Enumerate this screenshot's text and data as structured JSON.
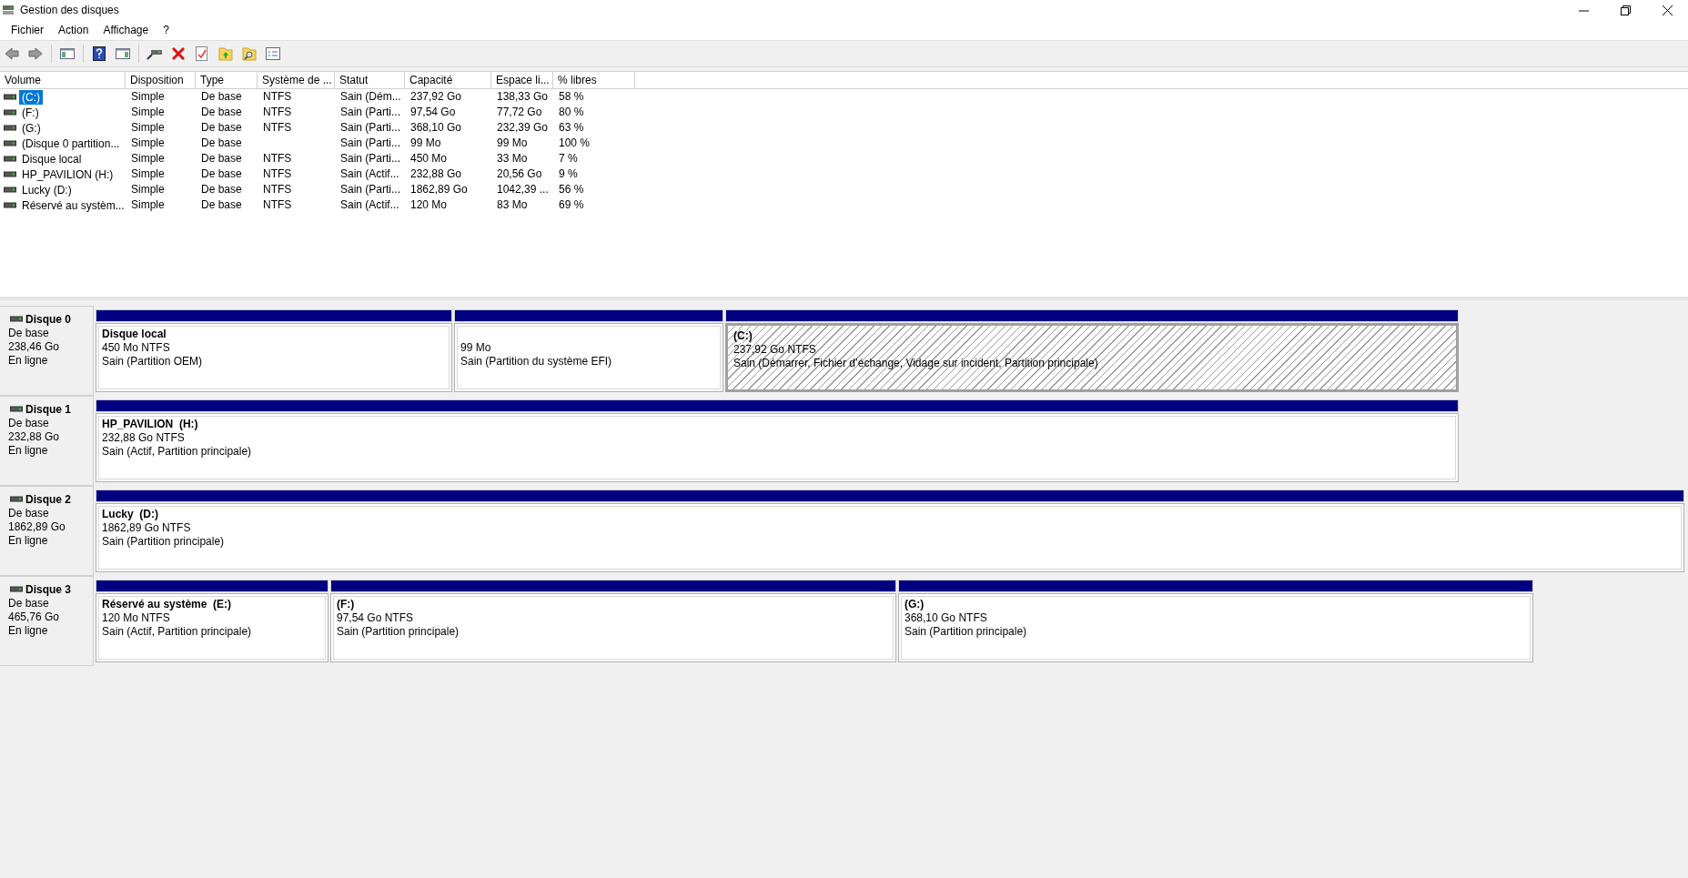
{
  "window": {
    "title": "Gestion des disques"
  },
  "menu": [
    "Fichier",
    "Action",
    "Affichage",
    "?"
  ],
  "table": {
    "columns": [
      "Volume",
      "Disposition",
      "Type",
      "Système de ...",
      "Statut",
      "Capacité",
      "Espace li...",
      "% libres"
    ],
    "rows": [
      {
        "selected": true,
        "cells": [
          "(C:)",
          "Simple",
          "De base",
          "NTFS",
          "Sain (Dém...",
          "237,92 Go",
          "138,33 Go",
          "58 %"
        ]
      },
      {
        "selected": false,
        "cells": [
          "(F:)",
          "Simple",
          "De base",
          "NTFS",
          "Sain (Parti...",
          "97,54 Go",
          "77,72 Go",
          "80 %"
        ]
      },
      {
        "selected": false,
        "cells": [
          "(G:)",
          "Simple",
          "De base",
          "NTFS",
          "Sain (Parti...",
          "368,10 Go",
          "232,39 Go",
          "63 %"
        ]
      },
      {
        "selected": false,
        "cells": [
          "(Disque 0 partition...",
          "Simple",
          "De base",
          "",
          "Sain (Parti...",
          "99 Mo",
          "99 Mo",
          "100 %"
        ]
      },
      {
        "selected": false,
        "cells": [
          "Disque local",
          "Simple",
          "De base",
          "NTFS",
          "Sain (Parti...",
          "450 Mo",
          "33 Mo",
          "7 %"
        ]
      },
      {
        "selected": false,
        "cells": [
          "HP_PAVILION (H:)",
          "Simple",
          "De base",
          "NTFS",
          "Sain (Actif...",
          "232,88 Go",
          "20,56 Go",
          "9 %"
        ]
      },
      {
        "selected": false,
        "cells": [
          "Lucky (D:)",
          "Simple",
          "De base",
          "NTFS",
          "Sain (Parti...",
          "1862,89 Go",
          "1042,39 ...",
          "56 %"
        ]
      },
      {
        "selected": false,
        "cells": [
          "Réservé au systèm...",
          "Simple",
          "De base",
          "NTFS",
          "Sain (Actif...",
          "120 Mo",
          "83 Mo",
          "69 %"
        ]
      }
    ]
  },
  "disks": [
    {
      "name": "Disque 0",
      "type": "De base",
      "size": "238,46 Go",
      "state": "En ligne",
      "partitions": [
        {
          "name": "Disque local",
          "size": "450 Mo NTFS",
          "status": "Sain (Partition OEM)",
          "selected": false
        },
        {
          "size": "99 Mo",
          "status": "Sain (Partition du système EFI)",
          "selected": false
        },
        {
          "name": "(C:)",
          "size": "237,92 Go NTFS",
          "status": "Sain (Démarrer, Fichier d’échange, Vidage sur incident, Partition principale)",
          "selected": true
        }
      ]
    },
    {
      "name": "Disque 1",
      "type": "De base",
      "size": "232,88 Go",
      "state": "En ligne",
      "partitions": [
        {
          "name": "HP_PAVILION  (H:)",
          "size": "232,88 Go NTFS",
          "status": "Sain (Actif, Partition principale)",
          "selected": false
        }
      ]
    },
    {
      "name": "Disque 2",
      "type": "De base",
      "size": "1862,89 Go",
      "state": "En ligne",
      "partitions": [
        {
          "name": "Lucky  (D:)",
          "size": "1862,89 Go NTFS",
          "status": "Sain (Partition principale)",
          "selected": false
        }
      ]
    },
    {
      "name": "Disque 3",
      "type": "De base",
      "size": "465,76 Go",
      "state": "En ligne",
      "partitions": [
        {
          "name": "Réservé au système  (E:)",
          "size": "120 Mo NTFS",
          "status": "Sain (Actif, Partition principale)",
          "selected": false
        },
        {
          "name": "(F:)",
          "size": "97,54 Go NTFS",
          "status": "Sain (Partition principale)",
          "selected": false
        },
        {
          "name": "(G:)",
          "size": "368,10 Go NTFS",
          "status": "Sain (Partition principale)",
          "selected": false
        }
      ]
    }
  ]
}
